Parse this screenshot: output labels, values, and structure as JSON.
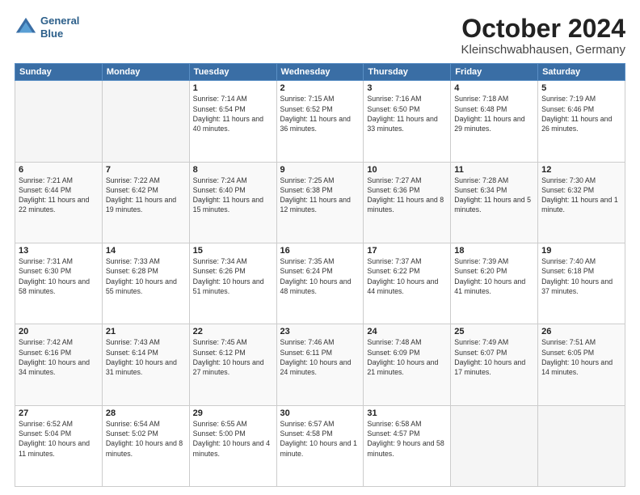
{
  "logo": {
    "line1": "General",
    "line2": "Blue"
  },
  "title": "October 2024",
  "location": "Kleinschwabhausen, Germany",
  "headers": [
    "Sunday",
    "Monday",
    "Tuesday",
    "Wednesday",
    "Thursday",
    "Friday",
    "Saturday"
  ],
  "weeks": [
    [
      {
        "day": "",
        "info": ""
      },
      {
        "day": "",
        "info": ""
      },
      {
        "day": "1",
        "info": "Sunrise: 7:14 AM\nSunset: 6:54 PM\nDaylight: 11 hours and 40 minutes."
      },
      {
        "day": "2",
        "info": "Sunrise: 7:15 AM\nSunset: 6:52 PM\nDaylight: 11 hours and 36 minutes."
      },
      {
        "day": "3",
        "info": "Sunrise: 7:16 AM\nSunset: 6:50 PM\nDaylight: 11 hours and 33 minutes."
      },
      {
        "day": "4",
        "info": "Sunrise: 7:18 AM\nSunset: 6:48 PM\nDaylight: 11 hours and 29 minutes."
      },
      {
        "day": "5",
        "info": "Sunrise: 7:19 AM\nSunset: 6:46 PM\nDaylight: 11 hours and 26 minutes."
      }
    ],
    [
      {
        "day": "6",
        "info": "Sunrise: 7:21 AM\nSunset: 6:44 PM\nDaylight: 11 hours and 22 minutes."
      },
      {
        "day": "7",
        "info": "Sunrise: 7:22 AM\nSunset: 6:42 PM\nDaylight: 11 hours and 19 minutes."
      },
      {
        "day": "8",
        "info": "Sunrise: 7:24 AM\nSunset: 6:40 PM\nDaylight: 11 hours and 15 minutes."
      },
      {
        "day": "9",
        "info": "Sunrise: 7:25 AM\nSunset: 6:38 PM\nDaylight: 11 hours and 12 minutes."
      },
      {
        "day": "10",
        "info": "Sunrise: 7:27 AM\nSunset: 6:36 PM\nDaylight: 11 hours and 8 minutes."
      },
      {
        "day": "11",
        "info": "Sunrise: 7:28 AM\nSunset: 6:34 PM\nDaylight: 11 hours and 5 minutes."
      },
      {
        "day": "12",
        "info": "Sunrise: 7:30 AM\nSunset: 6:32 PM\nDaylight: 11 hours and 1 minute."
      }
    ],
    [
      {
        "day": "13",
        "info": "Sunrise: 7:31 AM\nSunset: 6:30 PM\nDaylight: 10 hours and 58 minutes."
      },
      {
        "day": "14",
        "info": "Sunrise: 7:33 AM\nSunset: 6:28 PM\nDaylight: 10 hours and 55 minutes."
      },
      {
        "day": "15",
        "info": "Sunrise: 7:34 AM\nSunset: 6:26 PM\nDaylight: 10 hours and 51 minutes."
      },
      {
        "day": "16",
        "info": "Sunrise: 7:35 AM\nSunset: 6:24 PM\nDaylight: 10 hours and 48 minutes."
      },
      {
        "day": "17",
        "info": "Sunrise: 7:37 AM\nSunset: 6:22 PM\nDaylight: 10 hours and 44 minutes."
      },
      {
        "day": "18",
        "info": "Sunrise: 7:39 AM\nSunset: 6:20 PM\nDaylight: 10 hours and 41 minutes."
      },
      {
        "day": "19",
        "info": "Sunrise: 7:40 AM\nSunset: 6:18 PM\nDaylight: 10 hours and 37 minutes."
      }
    ],
    [
      {
        "day": "20",
        "info": "Sunrise: 7:42 AM\nSunset: 6:16 PM\nDaylight: 10 hours and 34 minutes."
      },
      {
        "day": "21",
        "info": "Sunrise: 7:43 AM\nSunset: 6:14 PM\nDaylight: 10 hours and 31 minutes."
      },
      {
        "day": "22",
        "info": "Sunrise: 7:45 AM\nSunset: 6:12 PM\nDaylight: 10 hours and 27 minutes."
      },
      {
        "day": "23",
        "info": "Sunrise: 7:46 AM\nSunset: 6:11 PM\nDaylight: 10 hours and 24 minutes."
      },
      {
        "day": "24",
        "info": "Sunrise: 7:48 AM\nSunset: 6:09 PM\nDaylight: 10 hours and 21 minutes."
      },
      {
        "day": "25",
        "info": "Sunrise: 7:49 AM\nSunset: 6:07 PM\nDaylight: 10 hours and 17 minutes."
      },
      {
        "day": "26",
        "info": "Sunrise: 7:51 AM\nSunset: 6:05 PM\nDaylight: 10 hours and 14 minutes."
      }
    ],
    [
      {
        "day": "27",
        "info": "Sunrise: 6:52 AM\nSunset: 5:04 PM\nDaylight: 10 hours and 11 minutes."
      },
      {
        "day": "28",
        "info": "Sunrise: 6:54 AM\nSunset: 5:02 PM\nDaylight: 10 hours and 8 minutes."
      },
      {
        "day": "29",
        "info": "Sunrise: 6:55 AM\nSunset: 5:00 PM\nDaylight: 10 hours and 4 minutes."
      },
      {
        "day": "30",
        "info": "Sunrise: 6:57 AM\nSunset: 4:58 PM\nDaylight: 10 hours and 1 minute."
      },
      {
        "day": "31",
        "info": "Sunrise: 6:58 AM\nSunset: 4:57 PM\nDaylight: 9 hours and 58 minutes."
      },
      {
        "day": "",
        "info": ""
      },
      {
        "day": "",
        "info": ""
      }
    ]
  ]
}
